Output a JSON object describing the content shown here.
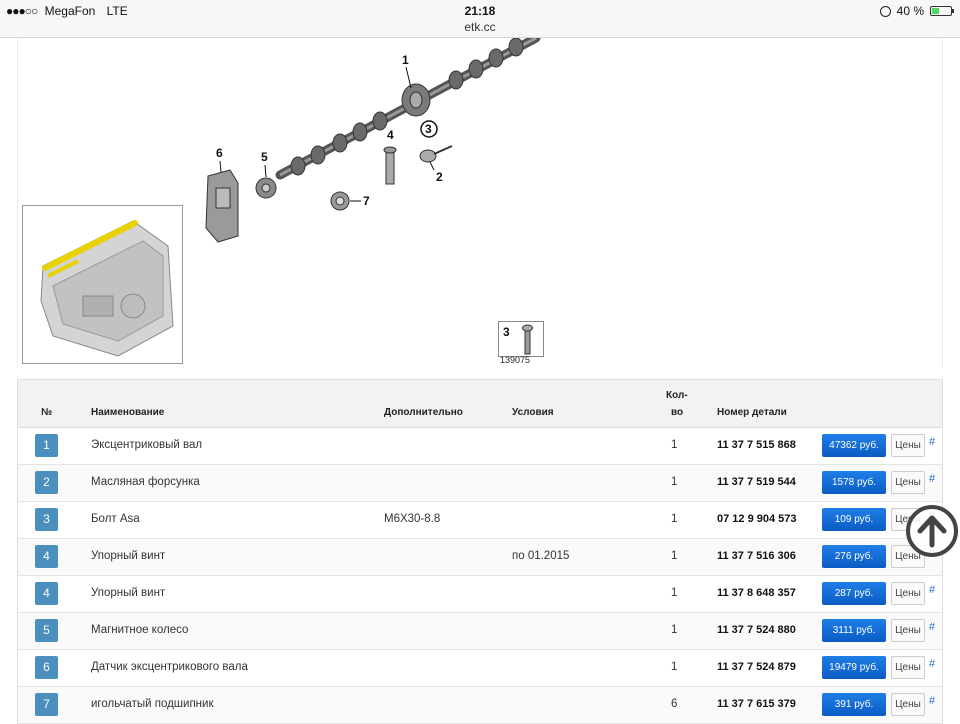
{
  "status": {
    "carrier": "MegaFon",
    "network": "LTE",
    "signal": "●●●○○",
    "time": "21:18",
    "url": "etk.cc",
    "battery_pct": "40 %",
    "battery_level": 0.4
  },
  "diagram": {
    "callouts": [
      "1",
      "2",
      "3",
      "4",
      "5",
      "6",
      "7"
    ],
    "legend_number": "3",
    "legend_code": "139075"
  },
  "table": {
    "headers": {
      "no": "№",
      "name": "Наименование",
      "extra": "Дополнительно",
      "cond": "Условия",
      "qty_line1": "Кол-",
      "qty_line2": "во",
      "part": "Номер детали"
    },
    "prices_label": "Цены",
    "hash": "#",
    "rows": [
      {
        "no": "1",
        "name": "Эксцентриковый вал",
        "extra": "",
        "cond": "",
        "qty": "1",
        "part": "11 37 7 515 868",
        "price": "47362 руб."
      },
      {
        "no": "2",
        "name": "Масляная форсунка",
        "extra": "",
        "cond": "",
        "qty": "1",
        "part": "11 37 7 519 544",
        "price": "1578 руб."
      },
      {
        "no": "3",
        "name": "Болт Asa",
        "extra": "M6X30-8.8",
        "cond": "",
        "qty": "1",
        "part": "07 12 9 904 573",
        "price": "109 руб."
      },
      {
        "no": "4",
        "name": "Упорный винт",
        "extra": "",
        "cond": "по 01.2015",
        "qty": "1",
        "part": "11 37 7 516 306",
        "price": "276 руб."
      },
      {
        "no": "4",
        "name": "Упорный винт",
        "extra": "",
        "cond": "",
        "qty": "1",
        "part": "11 37 8 648 357",
        "price": "287 руб."
      },
      {
        "no": "5",
        "name": "Магнитное колесо",
        "extra": "",
        "cond": "",
        "qty": "1",
        "part": "11 37 7 524 880",
        "price": "3111 руб."
      },
      {
        "no": "6",
        "name": "Датчик эксцентрикового вала",
        "extra": "",
        "cond": "",
        "qty": "1",
        "part": "11 37 7 524 879",
        "price": "19479 руб."
      },
      {
        "no": "7",
        "name": "игольчатый подшипник",
        "extra": "",
        "cond": "",
        "qty": "6",
        "part": "11 37 7 615 379",
        "price": "391 руб."
      }
    ]
  },
  "colors": {
    "number_badge": "#4a8fbd",
    "price_button": "#0a5cc4",
    "link": "#2a6fc9"
  }
}
